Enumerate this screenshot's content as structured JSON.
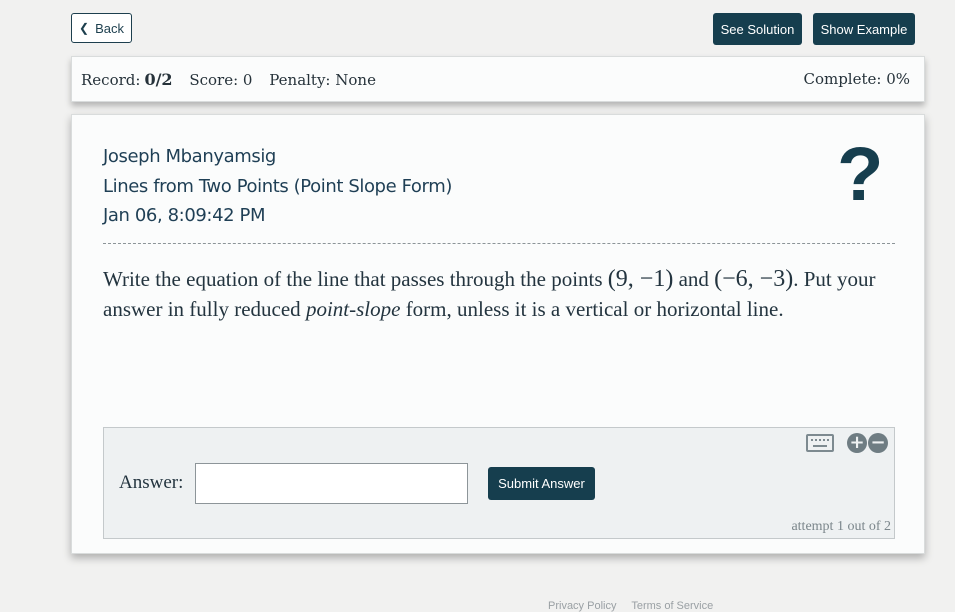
{
  "nav": {
    "back_label": "Back",
    "see_solution_label": "See Solution",
    "show_example_label": "Show Example"
  },
  "record_bar": {
    "record_label": "Record:",
    "record_value": "0/2",
    "score": "Score: 0",
    "penalty": "Penalty: None",
    "complete": "Complete: 0%"
  },
  "header": {
    "student_name": "Joseph Mbanyamsig",
    "assignment_title": "Lines from Two Points (Point Slope Form)",
    "timestamp": "Jan 06, 8:09:42 PM",
    "help_symbol": "?"
  },
  "question": {
    "part1": "Write the equation of the line that passes through the points ",
    "point1": "(9, −1)",
    "part2": " and ",
    "point2": "(−6, −3)",
    "part3": ". Put your answer in fully reduced ",
    "emphasis": "point-slope",
    "part4": " form, unless it is a vertical or horizontal line."
  },
  "answer": {
    "label": "Answer:",
    "input_value": "",
    "submit_label": "Submit Answer",
    "attempt_text": "attempt 1 out of 2",
    "icons": [
      "keyboard-icon",
      "plus-icon",
      "minus-icon"
    ]
  },
  "footer": {
    "links": [
      "Privacy Policy",
      "Terms of Service"
    ]
  },
  "colors": {
    "accent": "#163e4e",
    "background": "#f1f1f0",
    "card": "#fbfcfc",
    "answer_panel": "#eef1f2"
  }
}
